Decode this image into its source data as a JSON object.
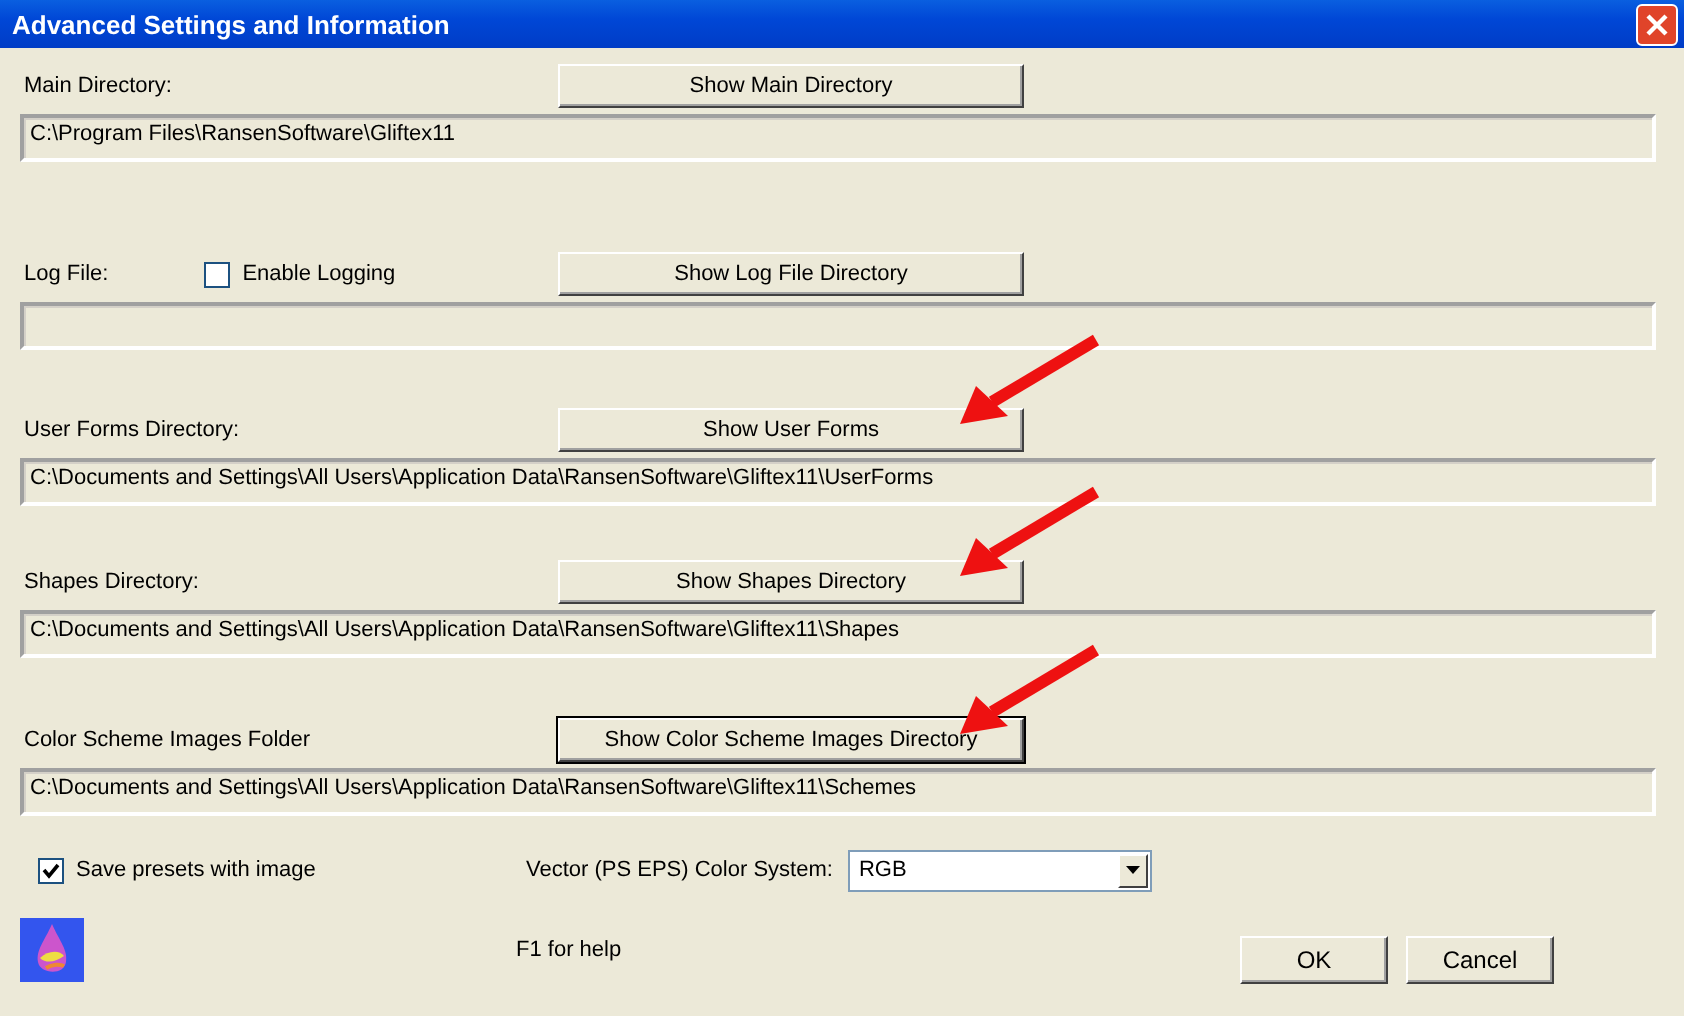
{
  "window": {
    "title": "Advanced Settings and Information"
  },
  "sections": [
    {
      "label": "Main Directory:",
      "button": "Show Main Directory",
      "path": "C:\\Program Files\\RansenSoftware\\Gliftex11",
      "default": false,
      "pointed": false
    },
    {
      "label": "Log File:",
      "checkbox": {
        "label": "Enable Logging",
        "checked": false
      },
      "button": "Show Log File Directory",
      "default": false,
      "pointed": false
    },
    {
      "label": "User Forms Directory:",
      "button": "Show User Forms",
      "path": "C:\\Documents and Settings\\All Users\\Application Data\\RansenSoftware\\Gliftex11\\UserForms",
      "default": false,
      "pointed": true
    },
    {
      "label": "Shapes Directory:",
      "button": "Show Shapes Directory",
      "path": "C:\\Documents and Settings\\All Users\\Application Data\\RansenSoftware\\Gliftex11\\Shapes",
      "default": false,
      "pointed": true
    },
    {
      "label": "Color Scheme Images Folder",
      "button": "Show Color Scheme Images Directory",
      "path": "C:\\Documents and Settings\\All Users\\Application Data\\RansenSoftware\\Gliftex11\\Schemes",
      "default": true,
      "pointed": true
    }
  ],
  "save_presets": {
    "label": "Save presets with image",
    "checked": true
  },
  "color_system": {
    "label": "Vector (PS EPS) Color System:",
    "value": "RGB"
  },
  "help": "F1 for help",
  "buttons": [
    "OK",
    "Cancel"
  ]
}
